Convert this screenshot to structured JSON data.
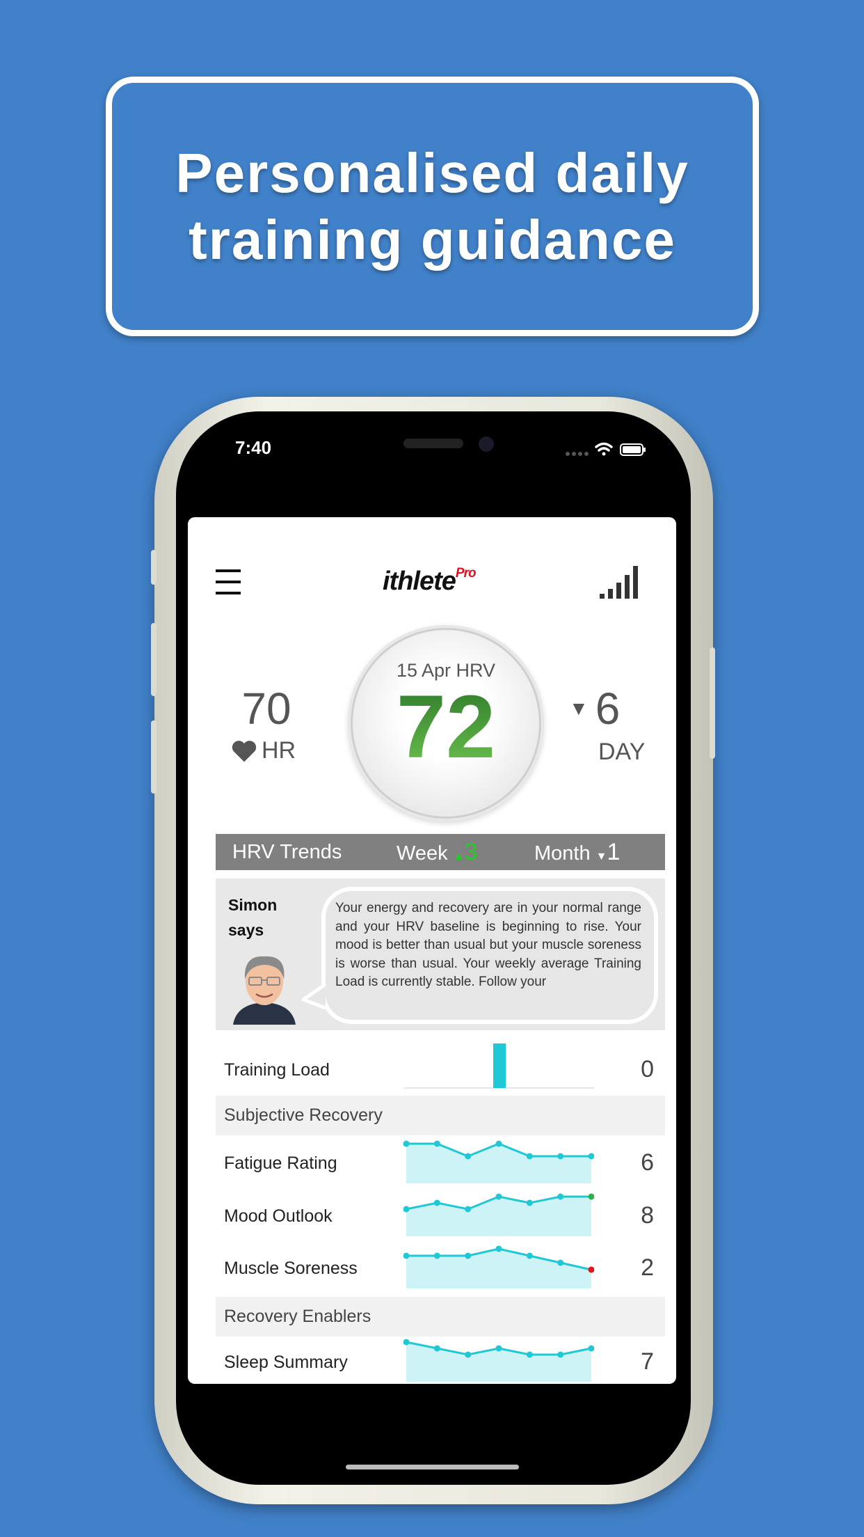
{
  "banner": {
    "line1": "Personalised daily",
    "line2": "training guidance"
  },
  "status_bar": {
    "time": "7:40",
    "icons": [
      "signal-dots-icon",
      "wifi-icon",
      "battery-icon"
    ]
  },
  "header": {
    "menu_icon": "hamburger-menu-icon",
    "logo": "ithlete",
    "logo_suffix": "Pro",
    "signal_icon": "signal-strength-icon"
  },
  "hrv": {
    "date_label": "15 Apr HRV",
    "value": "72"
  },
  "hr": {
    "value": "70",
    "label": "HR",
    "icon": "heart-icon"
  },
  "day": {
    "value": "6",
    "label": "DAY",
    "direction": "down"
  },
  "trends": {
    "title": "HRV Trends",
    "week_label": "Week",
    "week_value": "3",
    "week_direction": "up",
    "month_label": "Month",
    "month_value": "1",
    "month_direction": "down"
  },
  "simon": {
    "title_line1": "Simon",
    "title_line2": "says",
    "message": "Your energy and recovery are in your normal range and your HRV baseline is beginning to rise. Your mood is better than usual but your muscle soreness is worse than usual. Your weekly average Training Load is currently stable. Follow your"
  },
  "training_load": {
    "label": "Training Load",
    "value": "0"
  },
  "sections": {
    "subjective": "Subjective Recovery",
    "enablers": "Recovery Enablers"
  },
  "metrics": [
    {
      "label": "Fatigue Rating",
      "value": "6",
      "trend": [
        7,
        7,
        6,
        7,
        6,
        6,
        6
      ],
      "last_color": "#1ec8d4"
    },
    {
      "label": "Mood Outlook",
      "value": "8",
      "trend": [
        7,
        7.5,
        7,
        8,
        7.5,
        8,
        8
      ],
      "last_color": "#2bb24c"
    },
    {
      "label": "Muscle Soreness",
      "value": "2",
      "trend": [
        3,
        3,
        3,
        3.5,
        3,
        2.5,
        2
      ],
      "last_color": "#e8101a"
    },
    {
      "label": "Sleep Summary",
      "value": "7",
      "trend": [
        8,
        7.5,
        7,
        7.5,
        7,
        7,
        7.5
      ],
      "last_color": "#1ec8d4"
    }
  ],
  "colors": {
    "background": "#4181c9",
    "accent": "#1ec8d4",
    "hrv_green": "#3d9a35",
    "up": "#22cc22"
  }
}
